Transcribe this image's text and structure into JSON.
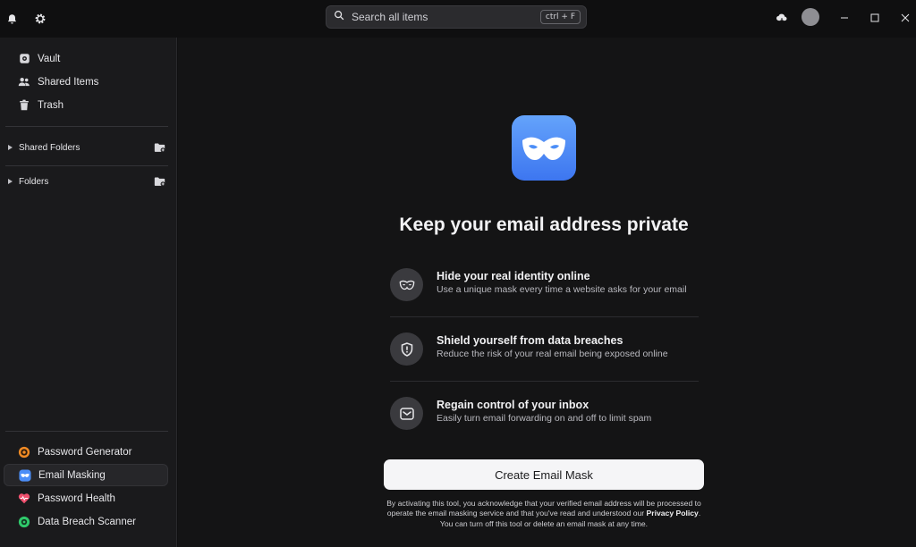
{
  "titlebar": {
    "search_placeholder": "Search all items",
    "search_shortcut": "ctrl + F",
    "icons": [
      "bell-icon",
      "gear-icon",
      "cloud-sync-icon",
      "avatar",
      "minimize-icon",
      "maximize-icon",
      "close-icon"
    ]
  },
  "sidebar": {
    "top_items": [
      {
        "label": "Vault",
        "icon": "vault-icon"
      },
      {
        "label": "Shared Items",
        "icon": "people-icon"
      },
      {
        "label": "Trash",
        "icon": "trash-icon"
      }
    ],
    "sections": [
      {
        "label": "Shared Folders",
        "icon": "add-folder-icon"
      },
      {
        "label": "Folders",
        "icon": "add-folder-icon"
      }
    ],
    "tools": [
      {
        "label": "Password Generator",
        "icon": "password-generator-icon",
        "color": "#f08a24"
      },
      {
        "label": "Email Masking",
        "icon": "email-mask-icon",
        "color": "#4c8ef7",
        "active": true
      },
      {
        "label": "Password Health",
        "icon": "heart-icon",
        "color": "#f0506e"
      },
      {
        "label": "Data Breach Scanner",
        "icon": "scanner-icon",
        "color": "#2fc96b"
      }
    ]
  },
  "main": {
    "heading": "Keep your email address private",
    "features": [
      {
        "title": "Hide your real identity online",
        "desc": "Use a unique mask every time a website asks for your email",
        "icon": "mask-icon"
      },
      {
        "title": "Shield yourself from data breaches",
        "desc": "Reduce the risk of your real email being exposed online",
        "icon": "shield-icon"
      },
      {
        "title": "Regain control of your inbox",
        "desc": "Easily turn email forwarding on and off to limit spam",
        "icon": "mail-icon"
      }
    ],
    "cta_label": "Create Email Mask",
    "legal_part1": "By activating this tool, you acknowledge that your verified email address will be processed to operate the email masking service and that you've read and understood our ",
    "legal_link": "Privacy Policy",
    "legal_part2": ". You can turn off this tool or delete an email mask at any time."
  },
  "colors": {
    "accent": "#4c8ef7",
    "background": "#141415",
    "sidebar": "#1a1a1c"
  }
}
